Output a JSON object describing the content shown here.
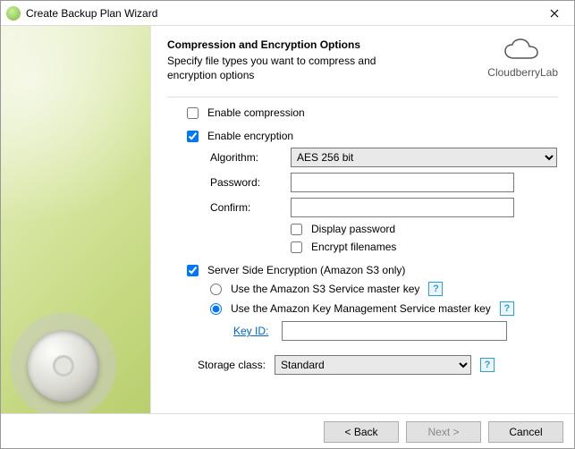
{
  "window": {
    "title": "Create Backup Plan Wizard"
  },
  "header": {
    "title": "Compression and Encryption Options",
    "subtitle": "Specify file types you want to compress and encryption options",
    "brand": "CloudberryLab"
  },
  "compression": {
    "enable_label": "Enable compression",
    "enabled": false
  },
  "encryption": {
    "enable_label": "Enable encryption",
    "enabled": true,
    "algorithm_label": "Algorithm:",
    "algorithm_value": "AES 256 bit",
    "password_label": "Password:",
    "password_value": "",
    "confirm_label": "Confirm:",
    "confirm_value": "",
    "display_password_label": "Display password",
    "display_password": false,
    "encrypt_filenames_label": "Encrypt filenames",
    "encrypt_filenames": false
  },
  "sse": {
    "enable_label": "Server Side Encryption (Amazon S3 only)",
    "enabled": true,
    "option_s3_label": "Use the Amazon S3 Service master key",
    "option_kms_label": "Use the Amazon Key Management Service master key",
    "selected": "kms",
    "key_id_label": "Key ID:",
    "key_id_value": ""
  },
  "storage": {
    "label": "Storage class:",
    "value": "Standard"
  },
  "footer": {
    "back": "< Back",
    "next": "Next >",
    "cancel": "Cancel"
  }
}
